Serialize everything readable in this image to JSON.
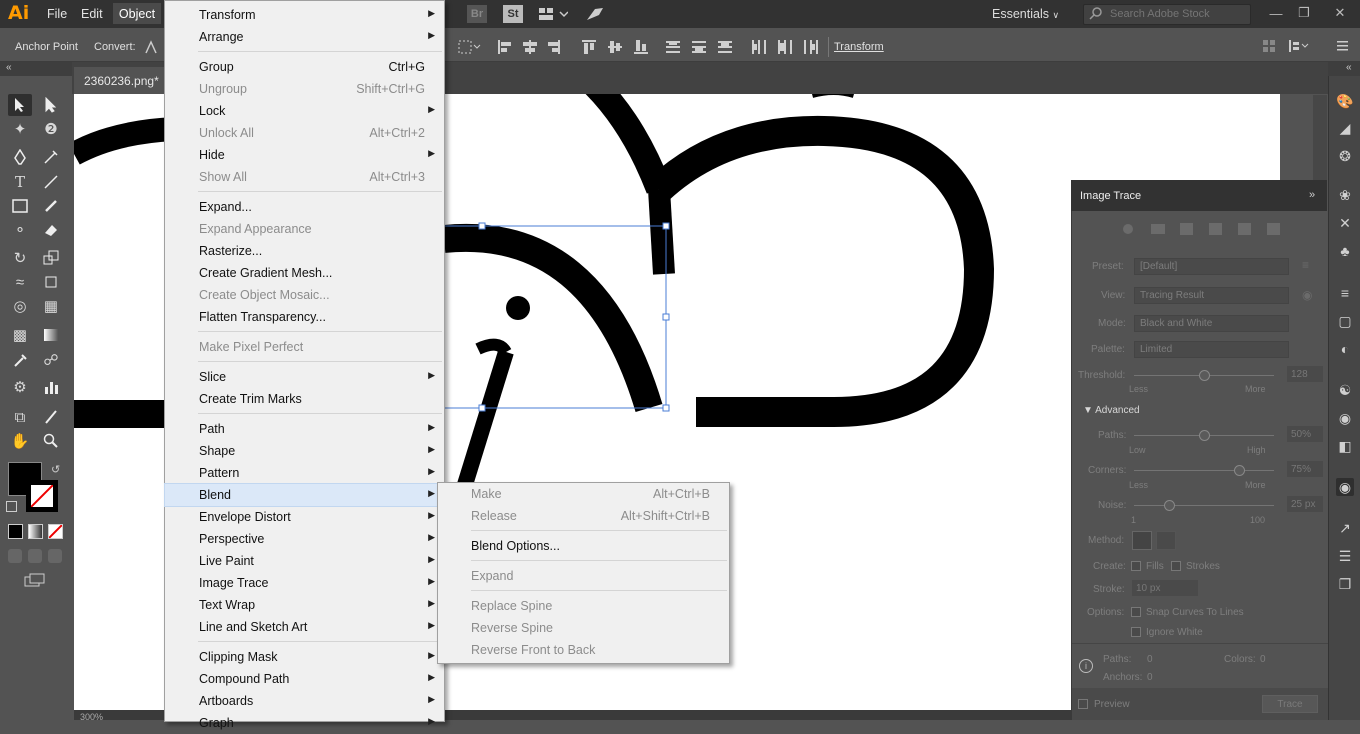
{
  "app": {
    "logo": "Ai"
  },
  "menubar": {
    "file": "File",
    "edit": "Edit",
    "object": "Object"
  },
  "top_icons": {
    "br": "Br",
    "st": "St"
  },
  "workspace": {
    "label": "Essentials"
  },
  "search": {
    "placeholder": "Search Adobe Stock"
  },
  "control_bar": {
    "anchor_point": "Anchor Point",
    "convert": "Convert:",
    "transform": "Transform"
  },
  "document": {
    "tab_title": "2360236.png*",
    "zoom": "300%"
  },
  "object_menu": {
    "items": [
      {
        "label": "Transform",
        "shortcut": "",
        "submenu": true,
        "disabled": false
      },
      {
        "label": "Arrange",
        "shortcut": "",
        "submenu": true,
        "disabled": false
      },
      {
        "label": "Group",
        "shortcut": "Ctrl+G",
        "submenu": false,
        "disabled": false
      },
      {
        "label": "Ungroup",
        "shortcut": "Shift+Ctrl+G",
        "submenu": false,
        "disabled": true
      },
      {
        "label": "Lock",
        "shortcut": "",
        "submenu": true,
        "disabled": false
      },
      {
        "label": "Unlock All",
        "shortcut": "Alt+Ctrl+2",
        "submenu": false,
        "disabled": true
      },
      {
        "label": "Hide",
        "shortcut": "",
        "submenu": true,
        "disabled": false
      },
      {
        "label": "Show All",
        "shortcut": "Alt+Ctrl+3",
        "submenu": false,
        "disabled": true
      },
      {
        "label": "Expand...",
        "shortcut": "",
        "submenu": false,
        "disabled": false
      },
      {
        "label": "Expand Appearance",
        "shortcut": "",
        "submenu": false,
        "disabled": true
      },
      {
        "label": "Rasterize...",
        "shortcut": "",
        "submenu": false,
        "disabled": false
      },
      {
        "label": "Create Gradient Mesh...",
        "shortcut": "",
        "submenu": false,
        "disabled": false
      },
      {
        "label": "Create Object Mosaic...",
        "shortcut": "",
        "submenu": false,
        "disabled": true
      },
      {
        "label": "Flatten Transparency...",
        "shortcut": "",
        "submenu": false,
        "disabled": false
      },
      {
        "label": "Make Pixel Perfect",
        "shortcut": "",
        "submenu": false,
        "disabled": true
      },
      {
        "label": "Slice",
        "shortcut": "",
        "submenu": true,
        "disabled": false
      },
      {
        "label": "Create Trim Marks",
        "shortcut": "",
        "submenu": false,
        "disabled": false
      },
      {
        "label": "Path",
        "shortcut": "",
        "submenu": true,
        "disabled": false
      },
      {
        "label": "Shape",
        "shortcut": "",
        "submenu": true,
        "disabled": false
      },
      {
        "label": "Pattern",
        "shortcut": "",
        "submenu": true,
        "disabled": false
      },
      {
        "label": "Blend",
        "shortcut": "",
        "submenu": true,
        "disabled": false,
        "highlighted": true
      },
      {
        "label": "Envelope Distort",
        "shortcut": "",
        "submenu": true,
        "disabled": false
      },
      {
        "label": "Perspective",
        "shortcut": "",
        "submenu": true,
        "disabled": false
      },
      {
        "label": "Live Paint",
        "shortcut": "",
        "submenu": true,
        "disabled": false
      },
      {
        "label": "Image Trace",
        "shortcut": "",
        "submenu": true,
        "disabled": false
      },
      {
        "label": "Text Wrap",
        "shortcut": "",
        "submenu": true,
        "disabled": false
      },
      {
        "label": "Line and Sketch Art",
        "shortcut": "",
        "submenu": true,
        "disabled": false
      },
      {
        "label": "Clipping Mask",
        "shortcut": "",
        "submenu": true,
        "disabled": false
      },
      {
        "label": "Compound Path",
        "shortcut": "",
        "submenu": true,
        "disabled": false
      },
      {
        "label": "Artboards",
        "shortcut": "",
        "submenu": true,
        "disabled": false
      },
      {
        "label": "Graph",
        "shortcut": "",
        "submenu": true,
        "disabled": false
      }
    ]
  },
  "blend_submenu": {
    "items": [
      {
        "label": "Make",
        "shortcut": "Alt+Ctrl+B",
        "disabled": true
      },
      {
        "label": "Release",
        "shortcut": "Alt+Shift+Ctrl+B",
        "disabled": true
      },
      {
        "label": "Blend Options...",
        "shortcut": "",
        "disabled": false
      },
      {
        "label": "Expand",
        "shortcut": "",
        "disabled": true
      },
      {
        "label": "Replace Spine",
        "shortcut": "",
        "disabled": true
      },
      {
        "label": "Reverse Spine",
        "shortcut": "",
        "disabled": true
      },
      {
        "label": "Reverse Front to Back",
        "shortcut": "",
        "disabled": true
      }
    ]
  },
  "image_trace": {
    "title": "Image Trace",
    "preset_label": "Preset:",
    "preset_value": "[Default]",
    "view_label": "View:",
    "view_value": "Tracing Result",
    "mode_label": "Mode:",
    "mode_value": "Black and White",
    "palette_label": "Palette:",
    "palette_value": "Limited",
    "threshold_label": "Threshold:",
    "threshold_value": "128",
    "threshold_min": "Less",
    "threshold_max": "More",
    "advanced_label": "Advanced",
    "paths_label": "Paths:",
    "paths_value": "50%",
    "paths_min": "Low",
    "paths_max": "High",
    "corners_label": "Corners:",
    "corners_value": "75%",
    "corners_min": "Less",
    "corners_max": "More",
    "noise_label": "Noise:",
    "noise_value": "25 px",
    "noise_min": "1",
    "noise_max": "100",
    "method_label": "Method:",
    "create_label": "Create:",
    "fills_label": "Fills",
    "strokes_label": "Strokes",
    "stroke_label": "Stroke:",
    "stroke_value": "10 px",
    "options_label": "Options:",
    "snap_label": "Snap Curves To Lines",
    "ignore_white_label": "Ignore White",
    "info_paths_label": "Paths:",
    "info_paths_value": "0",
    "info_colors_label": "Colors:",
    "info_colors_value": "0",
    "info_anchors_label": "Anchors:",
    "info_anchors_value": "0",
    "preview_label": "Preview",
    "trace_button": "Trace"
  },
  "slider_levels": {
    "threshold": 0.5,
    "paths": 0.5,
    "corners": 0.75,
    "noise": 0.25
  },
  "colors": {
    "accent": "#ff9a00",
    "menu_bg": "#f0f0f0",
    "highlight": "#dbe8f8",
    "ui_dark": "#323232",
    "ui_mid": "#535353",
    "selection": "#4a7cd4"
  }
}
